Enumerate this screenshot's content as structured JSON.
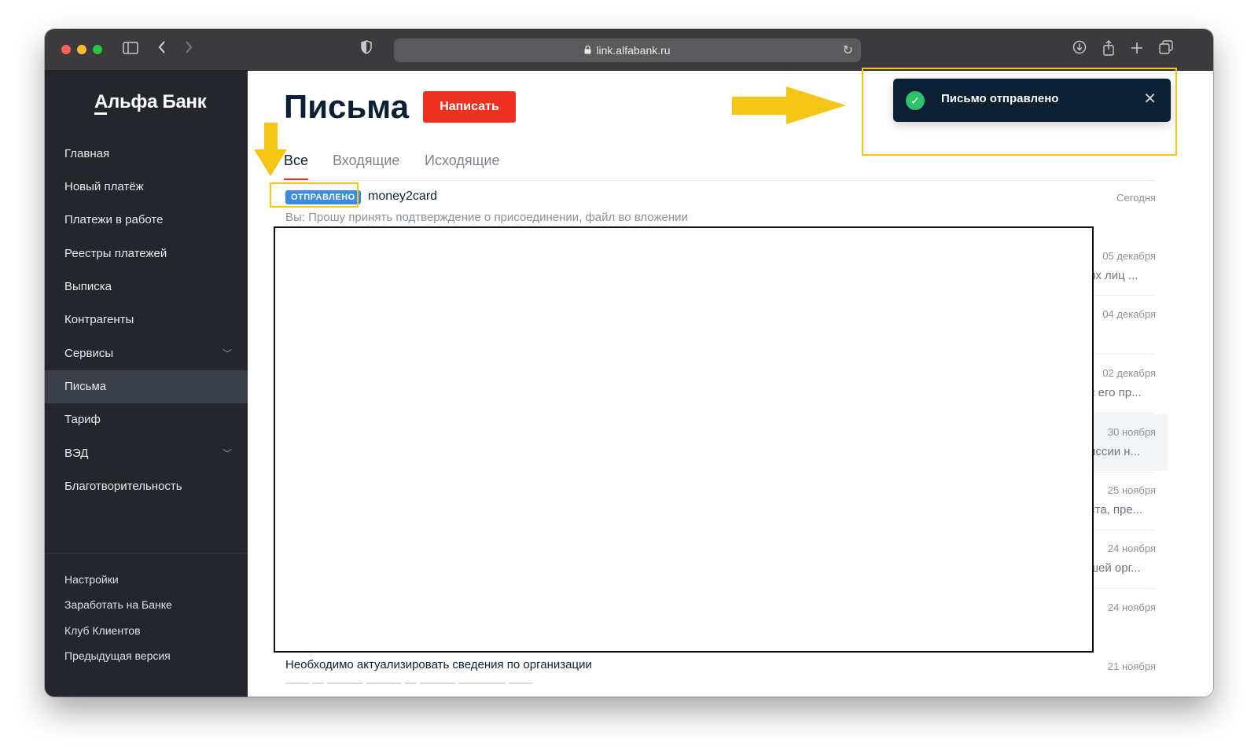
{
  "browser": {
    "url": "link.alfabank.ru",
    "icons": [
      "sidebar-toggle-icon",
      "back-icon",
      "forward-icon",
      "shield-icon",
      "lock-icon",
      "reload-icon",
      "download-icon",
      "share-icon",
      "new-tab-icon",
      "tabs-icon"
    ]
  },
  "sidebar": {
    "logo": "Альфа Банк",
    "items": [
      {
        "label": "Главная"
      },
      {
        "label": "Новый платёж"
      },
      {
        "label": "Платежи в работе"
      },
      {
        "label": "Реестры платежей"
      },
      {
        "label": "Выписка"
      },
      {
        "label": "Контрагенты"
      },
      {
        "label": "Сервисы",
        "expandable": true
      },
      {
        "label": "Письма",
        "active": true
      },
      {
        "label": "Тариф"
      },
      {
        "label": "ВЭД",
        "expandable": true
      },
      {
        "label": "Благотворительность"
      }
    ],
    "bottom_items": [
      {
        "label": "Настройки"
      },
      {
        "label": "Заработать на Банке"
      },
      {
        "label": "Клуб Клиентов"
      },
      {
        "label": "Предыдущая версия"
      }
    ]
  },
  "main": {
    "title": "Письма",
    "compose_label": "Написать",
    "tabs": [
      {
        "label": "Все",
        "active": true
      },
      {
        "label": "Входящие"
      },
      {
        "label": "Исходящие"
      }
    ],
    "first_message": {
      "badge": "ОТПРАВЛЕНО",
      "subject": "money2card",
      "preview": "Вы: Прошу принять подтверждение о присоединении, файл во вложении",
      "date": "Сегодня"
    },
    "messages": [
      {
        "date": "05 декабря",
        "snippet": "их лиц ..."
      },
      {
        "date": "04 декабря",
        "snippet": ""
      },
      {
        "date": "02 декабря",
        "snippet": "с его пр..."
      },
      {
        "date": "30 ноября",
        "snippet": "иссии н..."
      },
      {
        "date": "25 ноября",
        "snippet": "ста, пре..."
      },
      {
        "date": "24 ноября",
        "snippet": "шей орг..."
      },
      {
        "date": "24 ноября",
        "snippet": ""
      }
    ],
    "last_message": {
      "subject": "Необходимо актуализировать сведения по организации",
      "date": "21 ноября"
    }
  },
  "toast": {
    "text": "Письмо отправлено",
    "status_color": "#2fc26b"
  },
  "colors": {
    "brand_red": "#ef3124",
    "sidebar_bg": "#23262d",
    "toast_bg": "#0b1f35",
    "badge_blue": "#3d8be0",
    "annotation_yellow": "#f5c518"
  }
}
